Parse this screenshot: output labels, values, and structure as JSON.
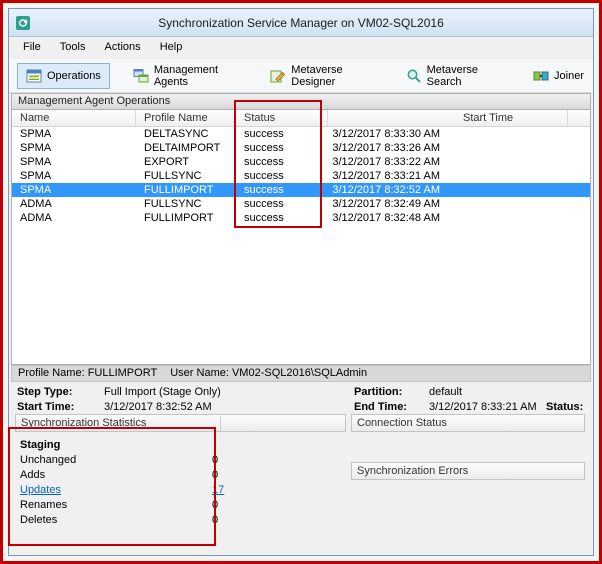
{
  "colors": {
    "annotation_red": "#c00000",
    "selection_blue": "#3297fd",
    "link_blue": "#0563c1",
    "titlebar_blue": "#d6e7f5"
  },
  "window": {
    "title": "Synchronization Service Manager on VM02-SQL2016",
    "menu": [
      "File",
      "Tools",
      "Actions",
      "Help"
    ]
  },
  "toolbar": {
    "buttons": [
      {
        "label": "Operations",
        "icon": "operations-icon",
        "active": true
      },
      {
        "label": "Management Agents",
        "icon": "management-agents-icon",
        "active": false
      },
      {
        "label": "Metaverse Designer",
        "icon": "metaverse-designer-icon",
        "active": false
      },
      {
        "label": "Metaverse Search",
        "icon": "metaverse-search-icon",
        "active": false
      },
      {
        "label": "Joiner",
        "icon": "joiner-icon",
        "active": false
      }
    ]
  },
  "operations": {
    "section_title": "Management Agent Operations",
    "columns": [
      "Name",
      "Profile Name",
      "Status",
      "Start Time"
    ],
    "rows": [
      {
        "name": "SPMA",
        "profile": "DELTASYNC",
        "status": "success",
        "start": "3/12/2017 8:33:30 AM",
        "selected": false
      },
      {
        "name": "SPMA",
        "profile": "DELTAIMPORT",
        "status": "success",
        "start": "3/12/2017 8:33:26 AM",
        "selected": false
      },
      {
        "name": "SPMA",
        "profile": "EXPORT",
        "status": "success",
        "start": "3/12/2017 8:33:22 AM",
        "selected": false
      },
      {
        "name": "SPMA",
        "profile": "FULLSYNC",
        "status": "success",
        "start": "3/12/2017 8:33:21 AM",
        "selected": false
      },
      {
        "name": "SPMA",
        "profile": "FULLIMPORT",
        "status": "success",
        "start": "3/12/2017 8:32:52 AM",
        "selected": true
      },
      {
        "name": "ADMA",
        "profile": "FULLSYNC",
        "status": "success",
        "start": "3/12/2017 8:32:49 AM",
        "selected": false
      },
      {
        "name": "ADMA",
        "profile": "FULLIMPORT",
        "status": "success",
        "start": "3/12/2017 8:32:48 AM",
        "selected": false
      }
    ]
  },
  "detail": {
    "profile_bar_left": "Profile Name: FULLIMPORT",
    "profile_bar_right": "User Name: VM02-SQL2016\\SQLAdmin",
    "step_type_label": "Step Type:",
    "step_type_value": "Full Import (Stage Only)",
    "start_time_label": "Start Time:",
    "start_time_value": "3/12/2017 8:32:52 AM",
    "partition_label": "Partition:",
    "partition_value": "default",
    "end_time_label": "End Time:",
    "end_time_value": "3/12/2017 8:33:21 AM",
    "status_label": "Status:"
  },
  "statistics": {
    "header": "Synchronization Statistics",
    "group": "Staging",
    "items": [
      {
        "label": "Unchanged",
        "value": "0",
        "link": false
      },
      {
        "label": "Adds",
        "value": "0",
        "link": false
      },
      {
        "label": "Updates",
        "value": "17",
        "link": true
      },
      {
        "label": "Renames",
        "value": "0",
        "link": false
      },
      {
        "label": "Deletes",
        "value": "0",
        "link": false
      }
    ]
  },
  "connection": {
    "header": "Connection Status"
  },
  "errors": {
    "header": "Synchronization Errors"
  }
}
